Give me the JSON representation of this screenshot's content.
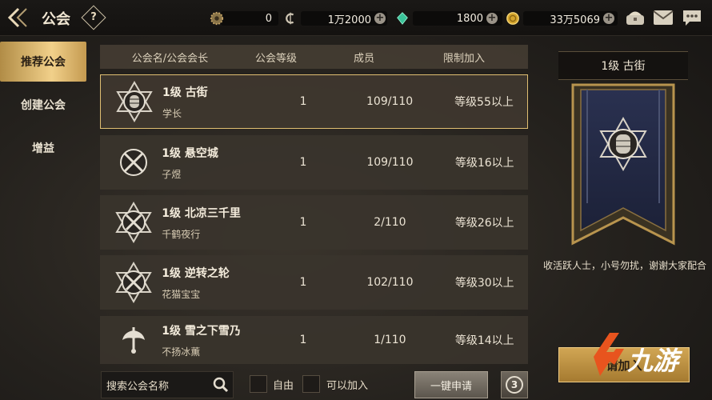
{
  "header": {
    "title": "公会",
    "help_glyph": "?",
    "resources": [
      {
        "icon": "gear-coin-icon",
        "value": "0"
      },
      {
        "icon": "currency-c-icon",
        "value": "1万2000"
      },
      {
        "icon": "green-gem-icon",
        "value": "1800"
      },
      {
        "icon": "gold-coin-icon",
        "value": "33万5069"
      }
    ]
  },
  "nav": {
    "items": [
      {
        "label": "推荐公会",
        "active": true
      },
      {
        "label": "创建公会",
        "active": false
      },
      {
        "label": "增益",
        "active": false
      }
    ]
  },
  "table": {
    "headers": {
      "name": "公会名/公会会长",
      "level": "公会等级",
      "members": "成员",
      "limit": "限制加入"
    },
    "rows": [
      {
        "name": "1级 古街",
        "leader": "学长",
        "level": "1",
        "members": "109/110",
        "limit": "等级55以上",
        "emblem": "hexagram-emblem-icon"
      },
      {
        "name": "1级 悬空城",
        "leader": "子煜",
        "level": "1",
        "members": "109/110",
        "limit": "等级16以上",
        "emblem": "crossed-swords-emblem-icon"
      },
      {
        "name": "1级 北凉三千里",
        "leader": "千鹤夜行",
        "level": "1",
        "members": "2/110",
        "limit": "等级26以上",
        "emblem": "crossed-swords-emblem-icon"
      },
      {
        "name": "1级 逆转之轮",
        "leader": "花猫宝宝",
        "level": "1",
        "members": "102/110",
        "limit": "等级30以上",
        "emblem": "crossed-swords-emblem-icon"
      },
      {
        "name": "1级 雪之下雪乃",
        "leader": "不扬冰薫",
        "level": "1",
        "members": "1/110",
        "limit": "等级14以上",
        "emblem": "axe-emblem-icon"
      }
    ]
  },
  "bottom": {
    "search_placeholder": "搜索公会名称",
    "filter_free": "自由",
    "filter_joinable": "可以加入",
    "apply_all": "一键申请",
    "refresh_count": "3"
  },
  "detail": {
    "title": "1级 古街",
    "description": "收活跃人士，小号勿扰，谢谢大家配合",
    "join_label": "请加入"
  },
  "watermark": {
    "text": "九游"
  },
  "colors": {
    "accent_gold": "#e0bf72",
    "row_bg": "#3a342c"
  }
}
